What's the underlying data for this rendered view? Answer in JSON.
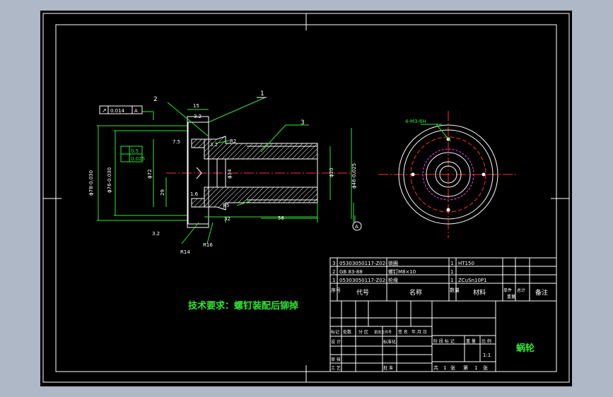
{
  "drawing": {
    "title": "蜗轮",
    "tech_requirement": "技术要求：螺钉装配后铆掉"
  },
  "balloons": {
    "b1": "1",
    "b2": "2",
    "b3": "3"
  },
  "dims": {
    "d15": "15",
    "d32a": "3.2",
    "d75": "7.5",
    "d32b": "3.2",
    "dR2": "R2",
    "d78": "ϕ78-0.030",
    "d76": "ϕ76-0.030",
    "d72": "ϕ72",
    "d29": "29",
    "d16": "1.6",
    "d34": "ϕ34",
    "dR5": "R5",
    "d32c": "32",
    "d56": "56",
    "d20": "ϕ20",
    "d46": "ϕ46-0.025",
    "dR14": "R14",
    "dR16": "R16",
    "d32d": "3.2",
    "tol05": "0.5",
    "tol0025": "0.025",
    "runout": "0.014",
    "datumA": "A",
    "datumA2": "A",
    "thread": "4-M3-6H"
  },
  "bom": {
    "rows": [
      {
        "no": "3",
        "code": "05303050117-Z02-",
        "name": "锁圈",
        "qty": "1",
        "material": "HT150"
      },
      {
        "no": "2",
        "code": "GB 83-88",
        "name": "螺钉M8×10",
        "qty": "1",
        "material": ""
      },
      {
        "no": "1",
        "code": "05303050117-Z02-",
        "name": "轮缘",
        "qty": "1",
        "material": "ZCuSn10P1"
      }
    ],
    "header": {
      "no": "序号",
      "code": "代号",
      "name": "名称",
      "qty": "数量",
      "material": "材料",
      "single": "单件",
      "total": "总计",
      "weight": "重量",
      "remark": "备注"
    }
  },
  "title_block": {
    "mark": "标记",
    "count": "处数",
    "zone": "分 区",
    "doc_no": "更改文件号",
    "sign": "签 名",
    "date": "年.月.日",
    "design": "设 计",
    "standard": "标准化",
    "check": "审 核",
    "process": "工 艺",
    "approve": "批 准",
    "stage": "阶 段 标 记",
    "weight": "重 量",
    "scale_label": "比 例",
    "scale": "1:1",
    "total": "共",
    "sheets": "张",
    "page": "第",
    "sheet": "张",
    "one": "1",
    "one2": "1"
  }
}
